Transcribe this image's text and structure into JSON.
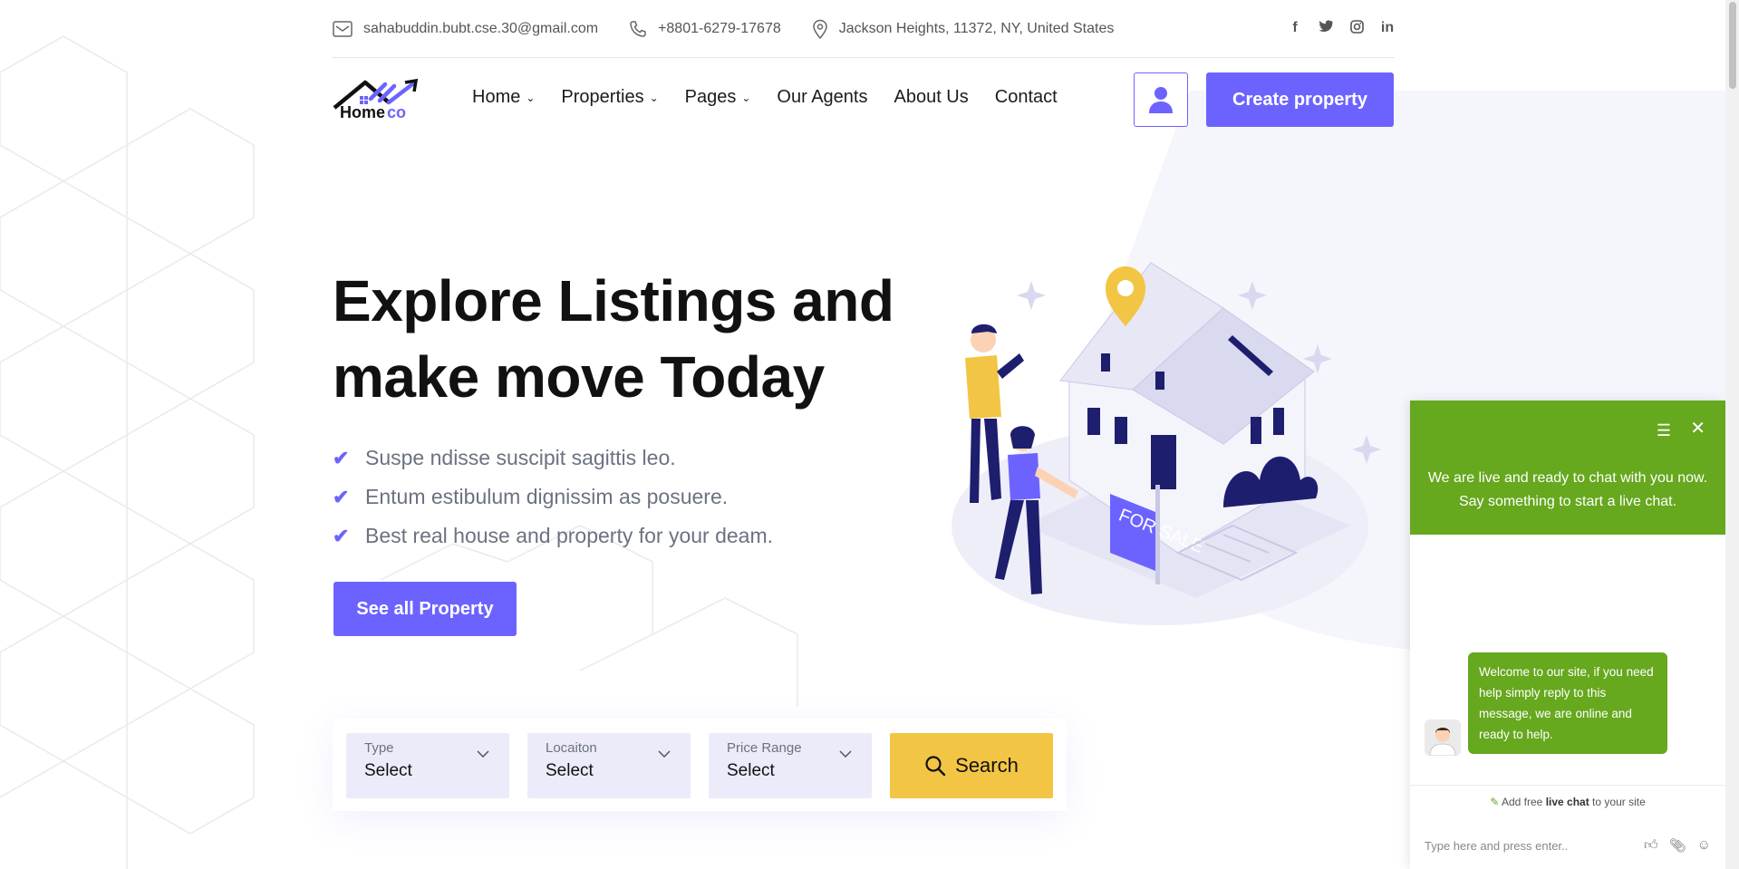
{
  "topbar": {
    "email": "sahabuddin.bubt.cse.30@gmail.com",
    "phone": "+8801-6279-17678",
    "address": "Jackson Heights, 11372, NY, United States",
    "socials": [
      "facebook-icon",
      "twitter-icon",
      "instagram-icon",
      "linkedin-icon"
    ]
  },
  "logo": {
    "word1": "Home",
    "word2": "co"
  },
  "nav": {
    "items": [
      {
        "label": "Home",
        "dropdown": true
      },
      {
        "label": "Properties",
        "dropdown": true
      },
      {
        "label": "Pages",
        "dropdown": true
      },
      {
        "label": "Our Agents",
        "dropdown": false
      },
      {
        "label": "About Us",
        "dropdown": false
      },
      {
        "label": "Contact",
        "dropdown": false
      }
    ],
    "create_label": "Create property"
  },
  "hero": {
    "title": "Explore Listings and make move Today",
    "bullets": [
      "Suspe ndisse suscipit sagittis leo.",
      "Entum estibulum dignissim as posuere.",
      "Best real house and property for your deam."
    ],
    "cta": "See all Property"
  },
  "illustration": {
    "sign_text": "FOR SALE"
  },
  "search": {
    "fields": [
      {
        "label": "Type",
        "value": "Select"
      },
      {
        "label": "Locaiton",
        "value": "Select"
      },
      {
        "label": "Price Range",
        "value": "Select"
      }
    ],
    "button_label": "Search"
  },
  "chat": {
    "header_text": "We are live and ready to chat with you now. Say something to start a live chat.",
    "welcome_message": "Welcome to our site, if you need help simply reply to this message, we are online and ready to help.",
    "promo_prefix": "Add free ",
    "promo_bold": "live chat",
    "promo_suffix": " to your site",
    "input_placeholder": "Type here and press enter.."
  },
  "colors": {
    "accent": "#6c63ff",
    "search": "#f3c544",
    "chat": "#66a81e"
  }
}
